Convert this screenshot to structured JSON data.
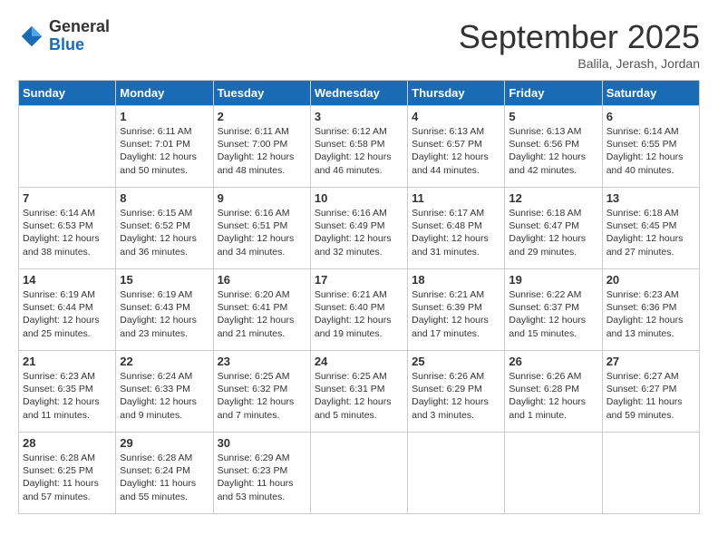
{
  "header": {
    "logo_general": "General",
    "logo_blue": "Blue",
    "month_title": "September 2025",
    "subtitle": "Balila, Jerash, Jordan"
  },
  "days_of_week": [
    "Sunday",
    "Monday",
    "Tuesday",
    "Wednesday",
    "Thursday",
    "Friday",
    "Saturday"
  ],
  "weeks": [
    [
      {
        "day": "",
        "sunrise": "",
        "sunset": "",
        "daylight": ""
      },
      {
        "day": "1",
        "sunrise": "Sunrise: 6:11 AM",
        "sunset": "Sunset: 7:01 PM",
        "daylight": "Daylight: 12 hours and 50 minutes."
      },
      {
        "day": "2",
        "sunrise": "Sunrise: 6:11 AM",
        "sunset": "Sunset: 7:00 PM",
        "daylight": "Daylight: 12 hours and 48 minutes."
      },
      {
        "day": "3",
        "sunrise": "Sunrise: 6:12 AM",
        "sunset": "Sunset: 6:58 PM",
        "daylight": "Daylight: 12 hours and 46 minutes."
      },
      {
        "day": "4",
        "sunrise": "Sunrise: 6:13 AM",
        "sunset": "Sunset: 6:57 PM",
        "daylight": "Daylight: 12 hours and 44 minutes."
      },
      {
        "day": "5",
        "sunrise": "Sunrise: 6:13 AM",
        "sunset": "Sunset: 6:56 PM",
        "daylight": "Daylight: 12 hours and 42 minutes."
      },
      {
        "day": "6",
        "sunrise": "Sunrise: 6:14 AM",
        "sunset": "Sunset: 6:55 PM",
        "daylight": "Daylight: 12 hours and 40 minutes."
      }
    ],
    [
      {
        "day": "7",
        "sunrise": "Sunrise: 6:14 AM",
        "sunset": "Sunset: 6:53 PM",
        "daylight": "Daylight: 12 hours and 38 minutes."
      },
      {
        "day": "8",
        "sunrise": "Sunrise: 6:15 AM",
        "sunset": "Sunset: 6:52 PM",
        "daylight": "Daylight: 12 hours and 36 minutes."
      },
      {
        "day": "9",
        "sunrise": "Sunrise: 6:16 AM",
        "sunset": "Sunset: 6:51 PM",
        "daylight": "Daylight: 12 hours and 34 minutes."
      },
      {
        "day": "10",
        "sunrise": "Sunrise: 6:16 AM",
        "sunset": "Sunset: 6:49 PM",
        "daylight": "Daylight: 12 hours and 32 minutes."
      },
      {
        "day": "11",
        "sunrise": "Sunrise: 6:17 AM",
        "sunset": "Sunset: 6:48 PM",
        "daylight": "Daylight: 12 hours and 31 minutes."
      },
      {
        "day": "12",
        "sunrise": "Sunrise: 6:18 AM",
        "sunset": "Sunset: 6:47 PM",
        "daylight": "Daylight: 12 hours and 29 minutes."
      },
      {
        "day": "13",
        "sunrise": "Sunrise: 6:18 AM",
        "sunset": "Sunset: 6:45 PM",
        "daylight": "Daylight: 12 hours and 27 minutes."
      }
    ],
    [
      {
        "day": "14",
        "sunrise": "Sunrise: 6:19 AM",
        "sunset": "Sunset: 6:44 PM",
        "daylight": "Daylight: 12 hours and 25 minutes."
      },
      {
        "day": "15",
        "sunrise": "Sunrise: 6:19 AM",
        "sunset": "Sunset: 6:43 PM",
        "daylight": "Daylight: 12 hours and 23 minutes."
      },
      {
        "day": "16",
        "sunrise": "Sunrise: 6:20 AM",
        "sunset": "Sunset: 6:41 PM",
        "daylight": "Daylight: 12 hours and 21 minutes."
      },
      {
        "day": "17",
        "sunrise": "Sunrise: 6:21 AM",
        "sunset": "Sunset: 6:40 PM",
        "daylight": "Daylight: 12 hours and 19 minutes."
      },
      {
        "day": "18",
        "sunrise": "Sunrise: 6:21 AM",
        "sunset": "Sunset: 6:39 PM",
        "daylight": "Daylight: 12 hours and 17 minutes."
      },
      {
        "day": "19",
        "sunrise": "Sunrise: 6:22 AM",
        "sunset": "Sunset: 6:37 PM",
        "daylight": "Daylight: 12 hours and 15 minutes."
      },
      {
        "day": "20",
        "sunrise": "Sunrise: 6:23 AM",
        "sunset": "Sunset: 6:36 PM",
        "daylight": "Daylight: 12 hours and 13 minutes."
      }
    ],
    [
      {
        "day": "21",
        "sunrise": "Sunrise: 6:23 AM",
        "sunset": "Sunset: 6:35 PM",
        "daylight": "Daylight: 12 hours and 11 minutes."
      },
      {
        "day": "22",
        "sunrise": "Sunrise: 6:24 AM",
        "sunset": "Sunset: 6:33 PM",
        "daylight": "Daylight: 12 hours and 9 minutes."
      },
      {
        "day": "23",
        "sunrise": "Sunrise: 6:25 AM",
        "sunset": "Sunset: 6:32 PM",
        "daylight": "Daylight: 12 hours and 7 minutes."
      },
      {
        "day": "24",
        "sunrise": "Sunrise: 6:25 AM",
        "sunset": "Sunset: 6:31 PM",
        "daylight": "Daylight: 12 hours and 5 minutes."
      },
      {
        "day": "25",
        "sunrise": "Sunrise: 6:26 AM",
        "sunset": "Sunset: 6:29 PM",
        "daylight": "Daylight: 12 hours and 3 minutes."
      },
      {
        "day": "26",
        "sunrise": "Sunrise: 6:26 AM",
        "sunset": "Sunset: 6:28 PM",
        "daylight": "Daylight: 12 hours and 1 minute."
      },
      {
        "day": "27",
        "sunrise": "Sunrise: 6:27 AM",
        "sunset": "Sunset: 6:27 PM",
        "daylight": "Daylight: 11 hours and 59 minutes."
      }
    ],
    [
      {
        "day": "28",
        "sunrise": "Sunrise: 6:28 AM",
        "sunset": "Sunset: 6:25 PM",
        "daylight": "Daylight: 11 hours and 57 minutes."
      },
      {
        "day": "29",
        "sunrise": "Sunrise: 6:28 AM",
        "sunset": "Sunset: 6:24 PM",
        "daylight": "Daylight: 11 hours and 55 minutes."
      },
      {
        "day": "30",
        "sunrise": "Sunrise: 6:29 AM",
        "sunset": "Sunset: 6:23 PM",
        "daylight": "Daylight: 11 hours and 53 minutes."
      },
      {
        "day": "",
        "sunrise": "",
        "sunset": "",
        "daylight": ""
      },
      {
        "day": "",
        "sunrise": "",
        "sunset": "",
        "daylight": ""
      },
      {
        "day": "",
        "sunrise": "",
        "sunset": "",
        "daylight": ""
      },
      {
        "day": "",
        "sunrise": "",
        "sunset": "",
        "daylight": ""
      }
    ]
  ]
}
